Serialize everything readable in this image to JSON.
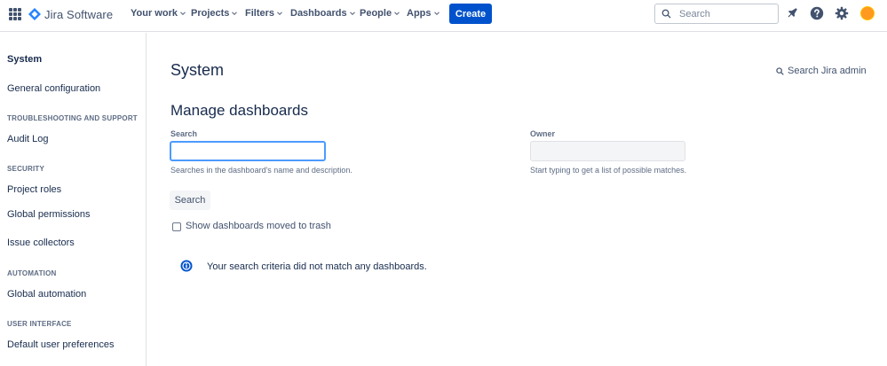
{
  "header": {
    "product_name": "Jira Software",
    "nav": [
      {
        "label": "Your work"
      },
      {
        "label": "Projects"
      },
      {
        "label": "Filters"
      },
      {
        "label": "Dashboards"
      },
      {
        "label": "People"
      },
      {
        "label": "Apps"
      }
    ],
    "create_label": "Create",
    "search_placeholder": "Search"
  },
  "sidebar": {
    "title": "System",
    "general_configuration": "General configuration",
    "sections": [
      {
        "heading": "TROUBLESHOOTING AND SUPPORT",
        "items": [
          "Audit Log"
        ]
      },
      {
        "heading": "SECURITY",
        "items": [
          "Project roles",
          "Global permissions",
          "Issue collectors"
        ]
      },
      {
        "heading": "AUTOMATION",
        "items": [
          "Global automation"
        ]
      },
      {
        "heading": "USER INTERFACE",
        "items": [
          "Default user preferences"
        ]
      }
    ]
  },
  "main": {
    "page_title": "System",
    "search_admin_label": "Search Jira admin",
    "section_title": "Manage dashboards",
    "search": {
      "label": "Search",
      "value": "",
      "help": "Searches in the dashboard's name and description."
    },
    "owner": {
      "label": "Owner",
      "value": "",
      "help": "Start typing to get a list of possible matches."
    },
    "search_button": "Search",
    "show_trash_label": "Show dashboards moved to trash",
    "show_trash_checked": false,
    "empty_message": "Your search criteria did not match any dashboards."
  },
  "colors": {
    "primary": "#0052cc",
    "focus_border": "#4c9aff",
    "text": "#172b4d",
    "subtle_text": "#5e6c84",
    "avatar": "#ff991f"
  }
}
